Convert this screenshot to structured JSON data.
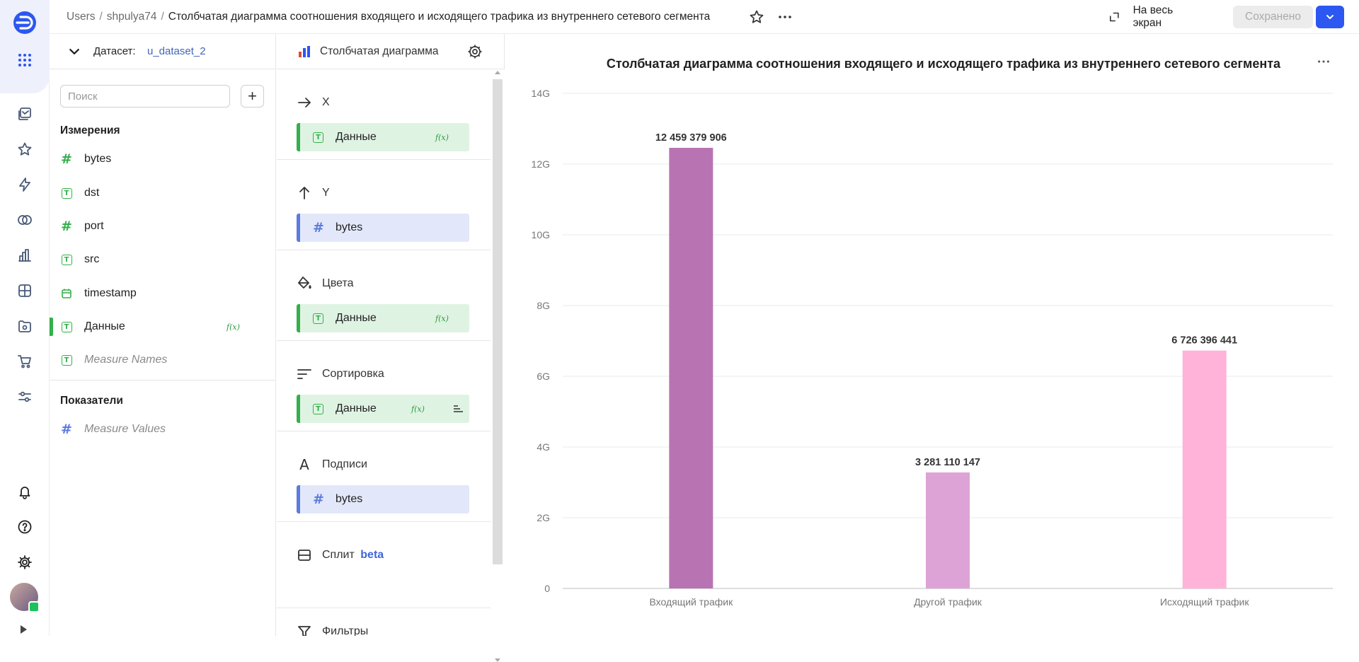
{
  "breadcrumb": {
    "items": [
      "Users",
      "shpulya74"
    ],
    "title": "Столбчатая диаграмма соотношения входящего и исходящего трафика из внутреннего сетевого сегмента"
  },
  "header": {
    "fullscreen_label": "На весь экран",
    "saved_label": "Сохранено"
  },
  "dataset": {
    "label": "Датасет:",
    "name": "u_dataset_2",
    "search_placeholder": "Поиск",
    "dimensions_title": "Измерения",
    "dimensions": [
      {
        "name": "bytes",
        "type": "number"
      },
      {
        "name": "dst",
        "type": "text"
      },
      {
        "name": "port",
        "type": "number"
      },
      {
        "name": "src",
        "type": "text"
      },
      {
        "name": "timestamp",
        "type": "date"
      },
      {
        "name": "Данные",
        "type": "text",
        "formula": "f(x)"
      },
      {
        "name": "Measure Names",
        "type": "text"
      }
    ],
    "measures_title": "Показатели",
    "measures": [
      {
        "name": "Measure Values",
        "type": "number"
      }
    ]
  },
  "wizard": {
    "chart_type_label": "Столбчатая диаграмма",
    "sections": {
      "x": {
        "title": "X",
        "field": "Данные",
        "formula": "f(x)"
      },
      "y": {
        "title": "Y",
        "field": "bytes"
      },
      "colors": {
        "title": "Цвета",
        "field": "Данные",
        "formula": "f(x)"
      },
      "sort": {
        "title": "Сортировка",
        "field": "Данные",
        "formula": "f(x)"
      },
      "labels": {
        "title": "Подписи",
        "field": "bytes"
      },
      "split": {
        "title": "Сплит",
        "badge": "beta"
      },
      "filters": {
        "title": "Фильтры"
      }
    }
  },
  "colors": {
    "accent": "#2c57f0",
    "dimension_green": "#33b04a",
    "measure_blue": "#5b7be0"
  },
  "chart_data": {
    "type": "bar",
    "title": "Столбчатая диаграмма соотношения входящего и исходящего трафика из внутреннего сетевого сегмента",
    "categories": [
      "Входящий трафик",
      "Другой трафик",
      "Исходящий трафик"
    ],
    "values": [
      12459379906,
      3281110147,
      6726396441
    ],
    "value_labels": [
      "12 459 379 906",
      "3 281 110 147",
      "6 726 396 441"
    ],
    "bar_colors": [
      "#b873b3",
      "#dda3d6",
      "#ffb3d9"
    ],
    "y_ticks": [
      "0",
      "2G",
      "4G",
      "6G",
      "8G",
      "10G",
      "12G",
      "14G"
    ],
    "ylim": [
      0,
      14000000000
    ],
    "grid": true
  }
}
